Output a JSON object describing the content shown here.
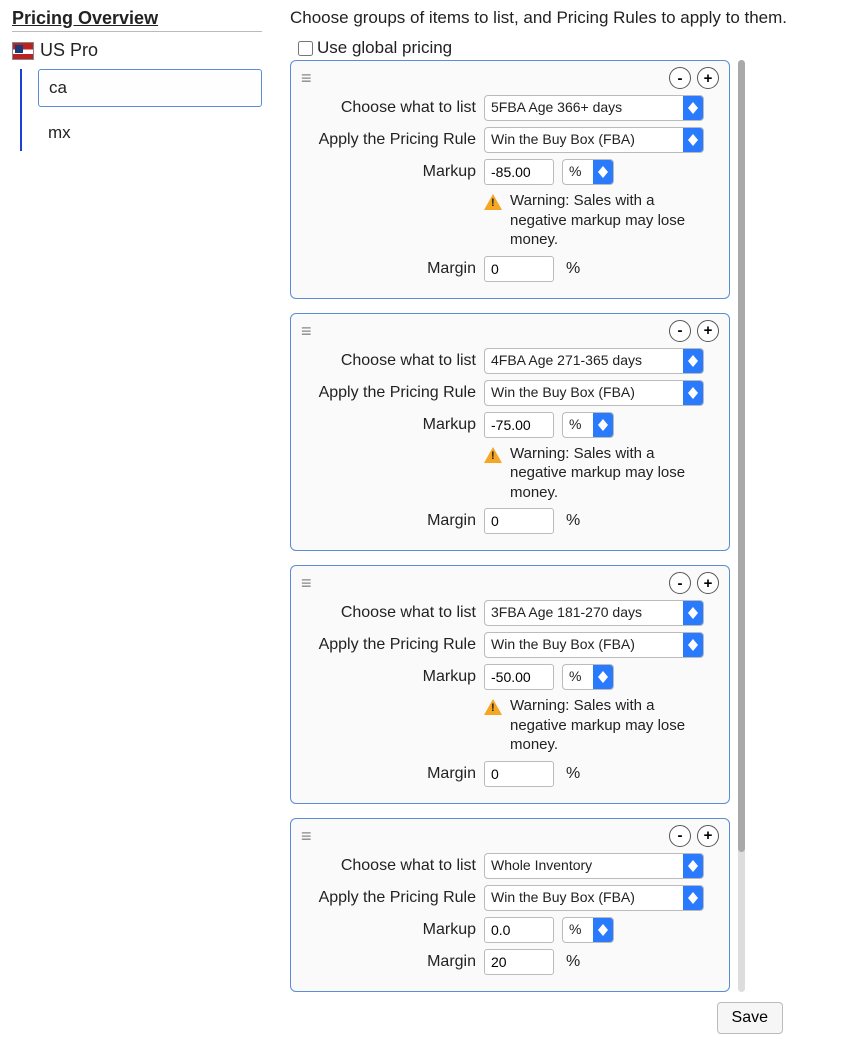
{
  "sidebar": {
    "title": "Pricing Overview",
    "account": "US Pro",
    "regions": [
      {
        "code": "ca",
        "selected": true
      },
      {
        "code": "mx",
        "selected": false
      }
    ]
  },
  "main": {
    "instruction": "Choose groups of items to list, and Pricing Rules to apply to them.",
    "global_label": "Use global pricing",
    "labels": {
      "choose": "Choose what to list",
      "apply_rule": "Apply the Pricing Rule",
      "markup": "Markup",
      "margin": "Margin"
    },
    "warning_text": "Warning: Sales with a negative markup may lose money.",
    "percent_symbol": "%",
    "save_label": "Save",
    "rules": [
      {
        "list": "5FBA Age 366+ days",
        "rule": "Win the Buy Box (FBA)",
        "markup": "-85.00",
        "markup_unit": "%",
        "margin": "0",
        "show_warning": true,
        "first": true
      },
      {
        "list": "4FBA Age 271-365 days",
        "rule": "Win the Buy Box (FBA)",
        "markup": "-75.00",
        "markup_unit": "%",
        "margin": "0",
        "show_warning": true,
        "first": false
      },
      {
        "list": "3FBA Age 181-270 days",
        "rule": "Win the Buy Box (FBA)",
        "markup": "-50.00",
        "markup_unit": "%",
        "margin": "0",
        "show_warning": true,
        "first": false
      },
      {
        "list": "Whole Inventory",
        "rule": "Win the Buy Box (FBA)",
        "markup": "0.0",
        "markup_unit": "%",
        "margin": "20",
        "show_warning": false,
        "first": false
      }
    ]
  }
}
